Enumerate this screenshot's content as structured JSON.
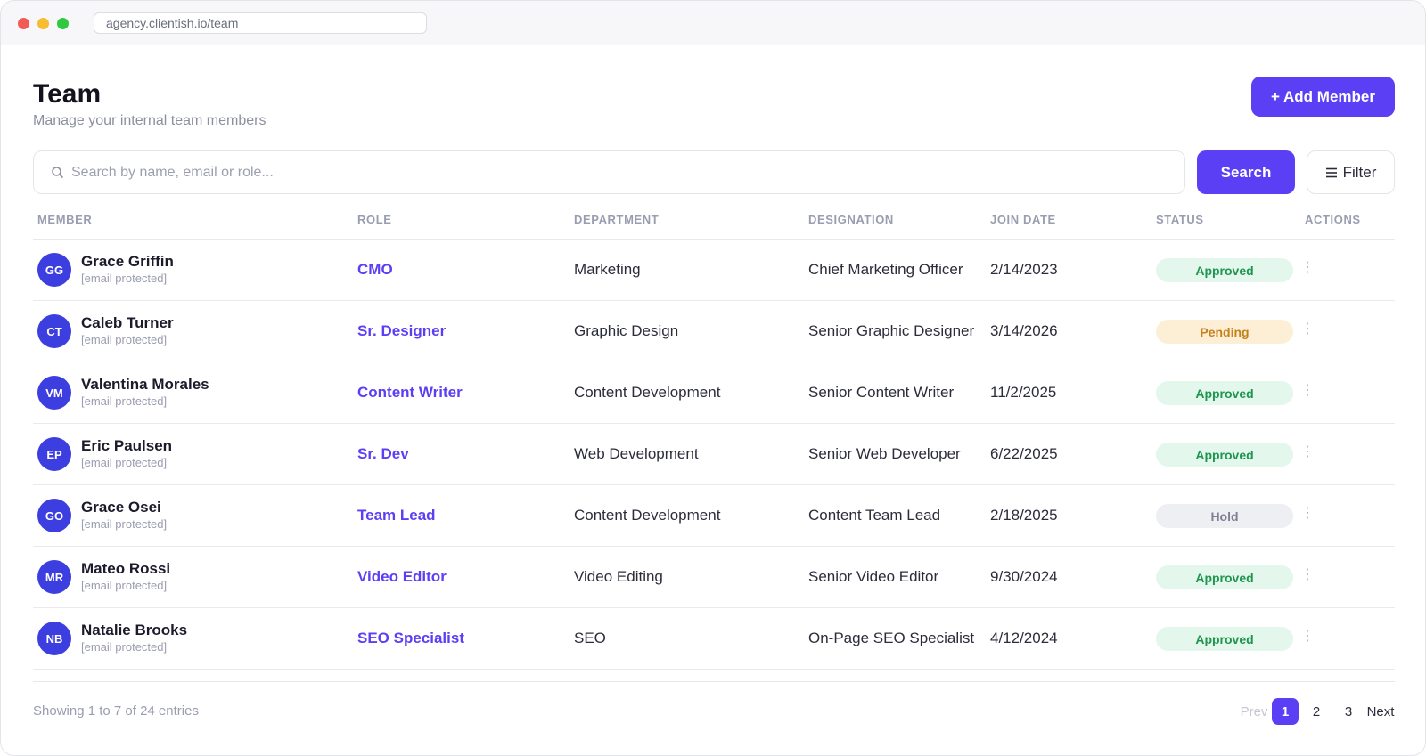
{
  "browser": {
    "url": "agency.clientish.io/team"
  },
  "header": {
    "title": "Team",
    "subtitle": "Manage your internal team members",
    "add_button_label": "+ Add Member"
  },
  "search": {
    "placeholder": "Search by name, email or role...",
    "value": "",
    "button_label": "Search",
    "filter_label": "Filter"
  },
  "table": {
    "columns": [
      "MEMBER",
      "ROLE",
      "DEPARTMENT",
      "DESIGNATION",
      "JOIN DATE",
      "STATUS",
      "ACTIONS"
    ],
    "rows": [
      {
        "initials": "GG",
        "name": "Grace Griffin",
        "email": "[email protected]",
        "role": "CMO",
        "department": "Marketing",
        "designation": "Chief Marketing Officer",
        "join_date": "2/14/2023",
        "status": "Approved",
        "action": "⋮"
      },
      {
        "initials": "CT",
        "name": "Caleb Turner",
        "email": "[email protected]",
        "role": "Sr. Designer",
        "department": "Graphic Design",
        "designation": "Senior Graphic Designer",
        "join_date": "3/14/2026",
        "status": "Pending",
        "action": "⋮"
      },
      {
        "initials": "VM",
        "name": "Valentina Morales",
        "email": "[email protected]",
        "role": "Content Writer",
        "department": "Content Development",
        "designation": "Senior Content Writer",
        "join_date": "11/2/2025",
        "status": "Approved",
        "action": "⋮"
      },
      {
        "initials": "EP",
        "name": "Eric Paulsen",
        "email": "[email protected]",
        "role": "Sr. Dev",
        "department": "Web Development",
        "designation": "Senior Web Developer",
        "join_date": "6/22/2025",
        "status": "Approved",
        "action": "⋮"
      },
      {
        "initials": "GO",
        "name": "Grace Osei",
        "email": "[email protected]",
        "role": "Team Lead",
        "department": "Content Development",
        "designation": "Content Team Lead",
        "join_date": "2/18/2025",
        "status": "Hold",
        "action": "⋮"
      },
      {
        "initials": "MR",
        "name": "Mateo Rossi",
        "email": "[email protected]",
        "role": "Video Editor",
        "department": "Video Editing",
        "designation": "Senior Video Editor",
        "join_date": "9/30/2024",
        "status": "Approved",
        "action": "⋮"
      },
      {
        "initials": "NB",
        "name": "Natalie Brooks",
        "email": "[email protected]",
        "role": "SEO Specialist",
        "department": "SEO",
        "designation": "On-Page SEO Specialist",
        "join_date": "4/12/2024",
        "status": "Approved",
        "action": "⋮"
      }
    ]
  },
  "pagination": {
    "summary": "Showing 1 to 7 of 24 entries",
    "prev": "Prev",
    "pages": [
      "1",
      "2",
      "3"
    ],
    "current": "1",
    "next": "Next"
  },
  "colors": {
    "accent": "#5b3ff5",
    "avatar": "#3d3ee0",
    "approved": "#1f9650",
    "pending": "#c5821c",
    "hold": "#7d8093"
  }
}
